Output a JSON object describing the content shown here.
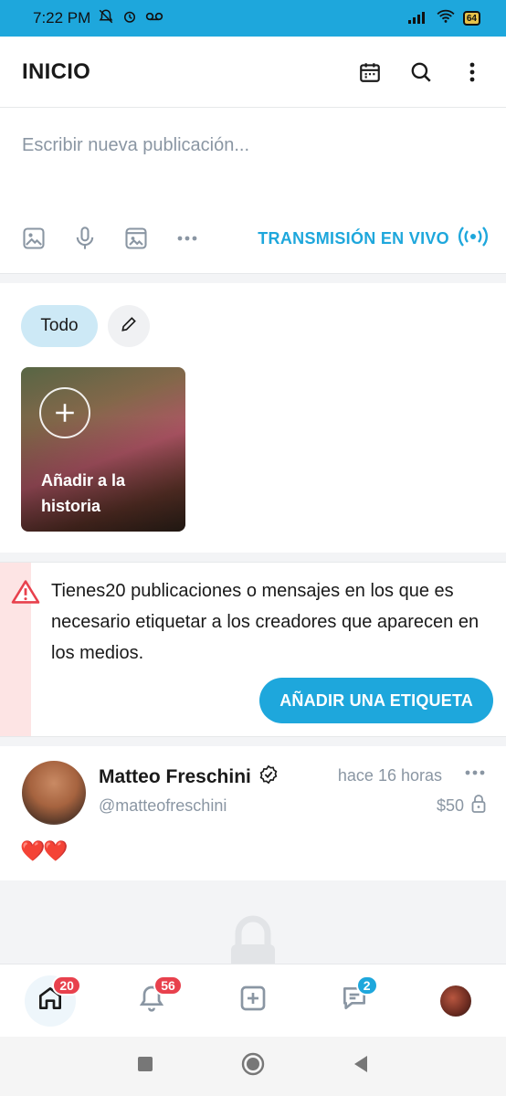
{
  "status_bar": {
    "time": "7:22 PM",
    "battery": "64"
  },
  "header": {
    "title": "INICIO"
  },
  "composer": {
    "placeholder": "Escribir nueva publicación...",
    "live_label": "TRANSMISIÓN EN VIVO"
  },
  "stories": {
    "filter_label": "Todo",
    "add_story_label": "Añadir a la historia"
  },
  "alert": {
    "message": "Tienes20 publicaciones o mensajes en los que es necesario etiquetar a los creadores que aparecen en los medios.",
    "button_label": "AÑADIR UNA ETIQUETA"
  },
  "post": {
    "author_name": "Matteo Freschini",
    "handle": "@matteofreschini",
    "time": "hace 16 horas",
    "price": "$50",
    "content": "❤️❤️"
  },
  "bottom_nav": {
    "home_badge": "20",
    "notifications_badge": "56",
    "messages_badge": "2"
  },
  "colors": {
    "accent": "#1ea7dc",
    "badge": "#e8414d",
    "alert_stripe": "#fde4e4"
  }
}
